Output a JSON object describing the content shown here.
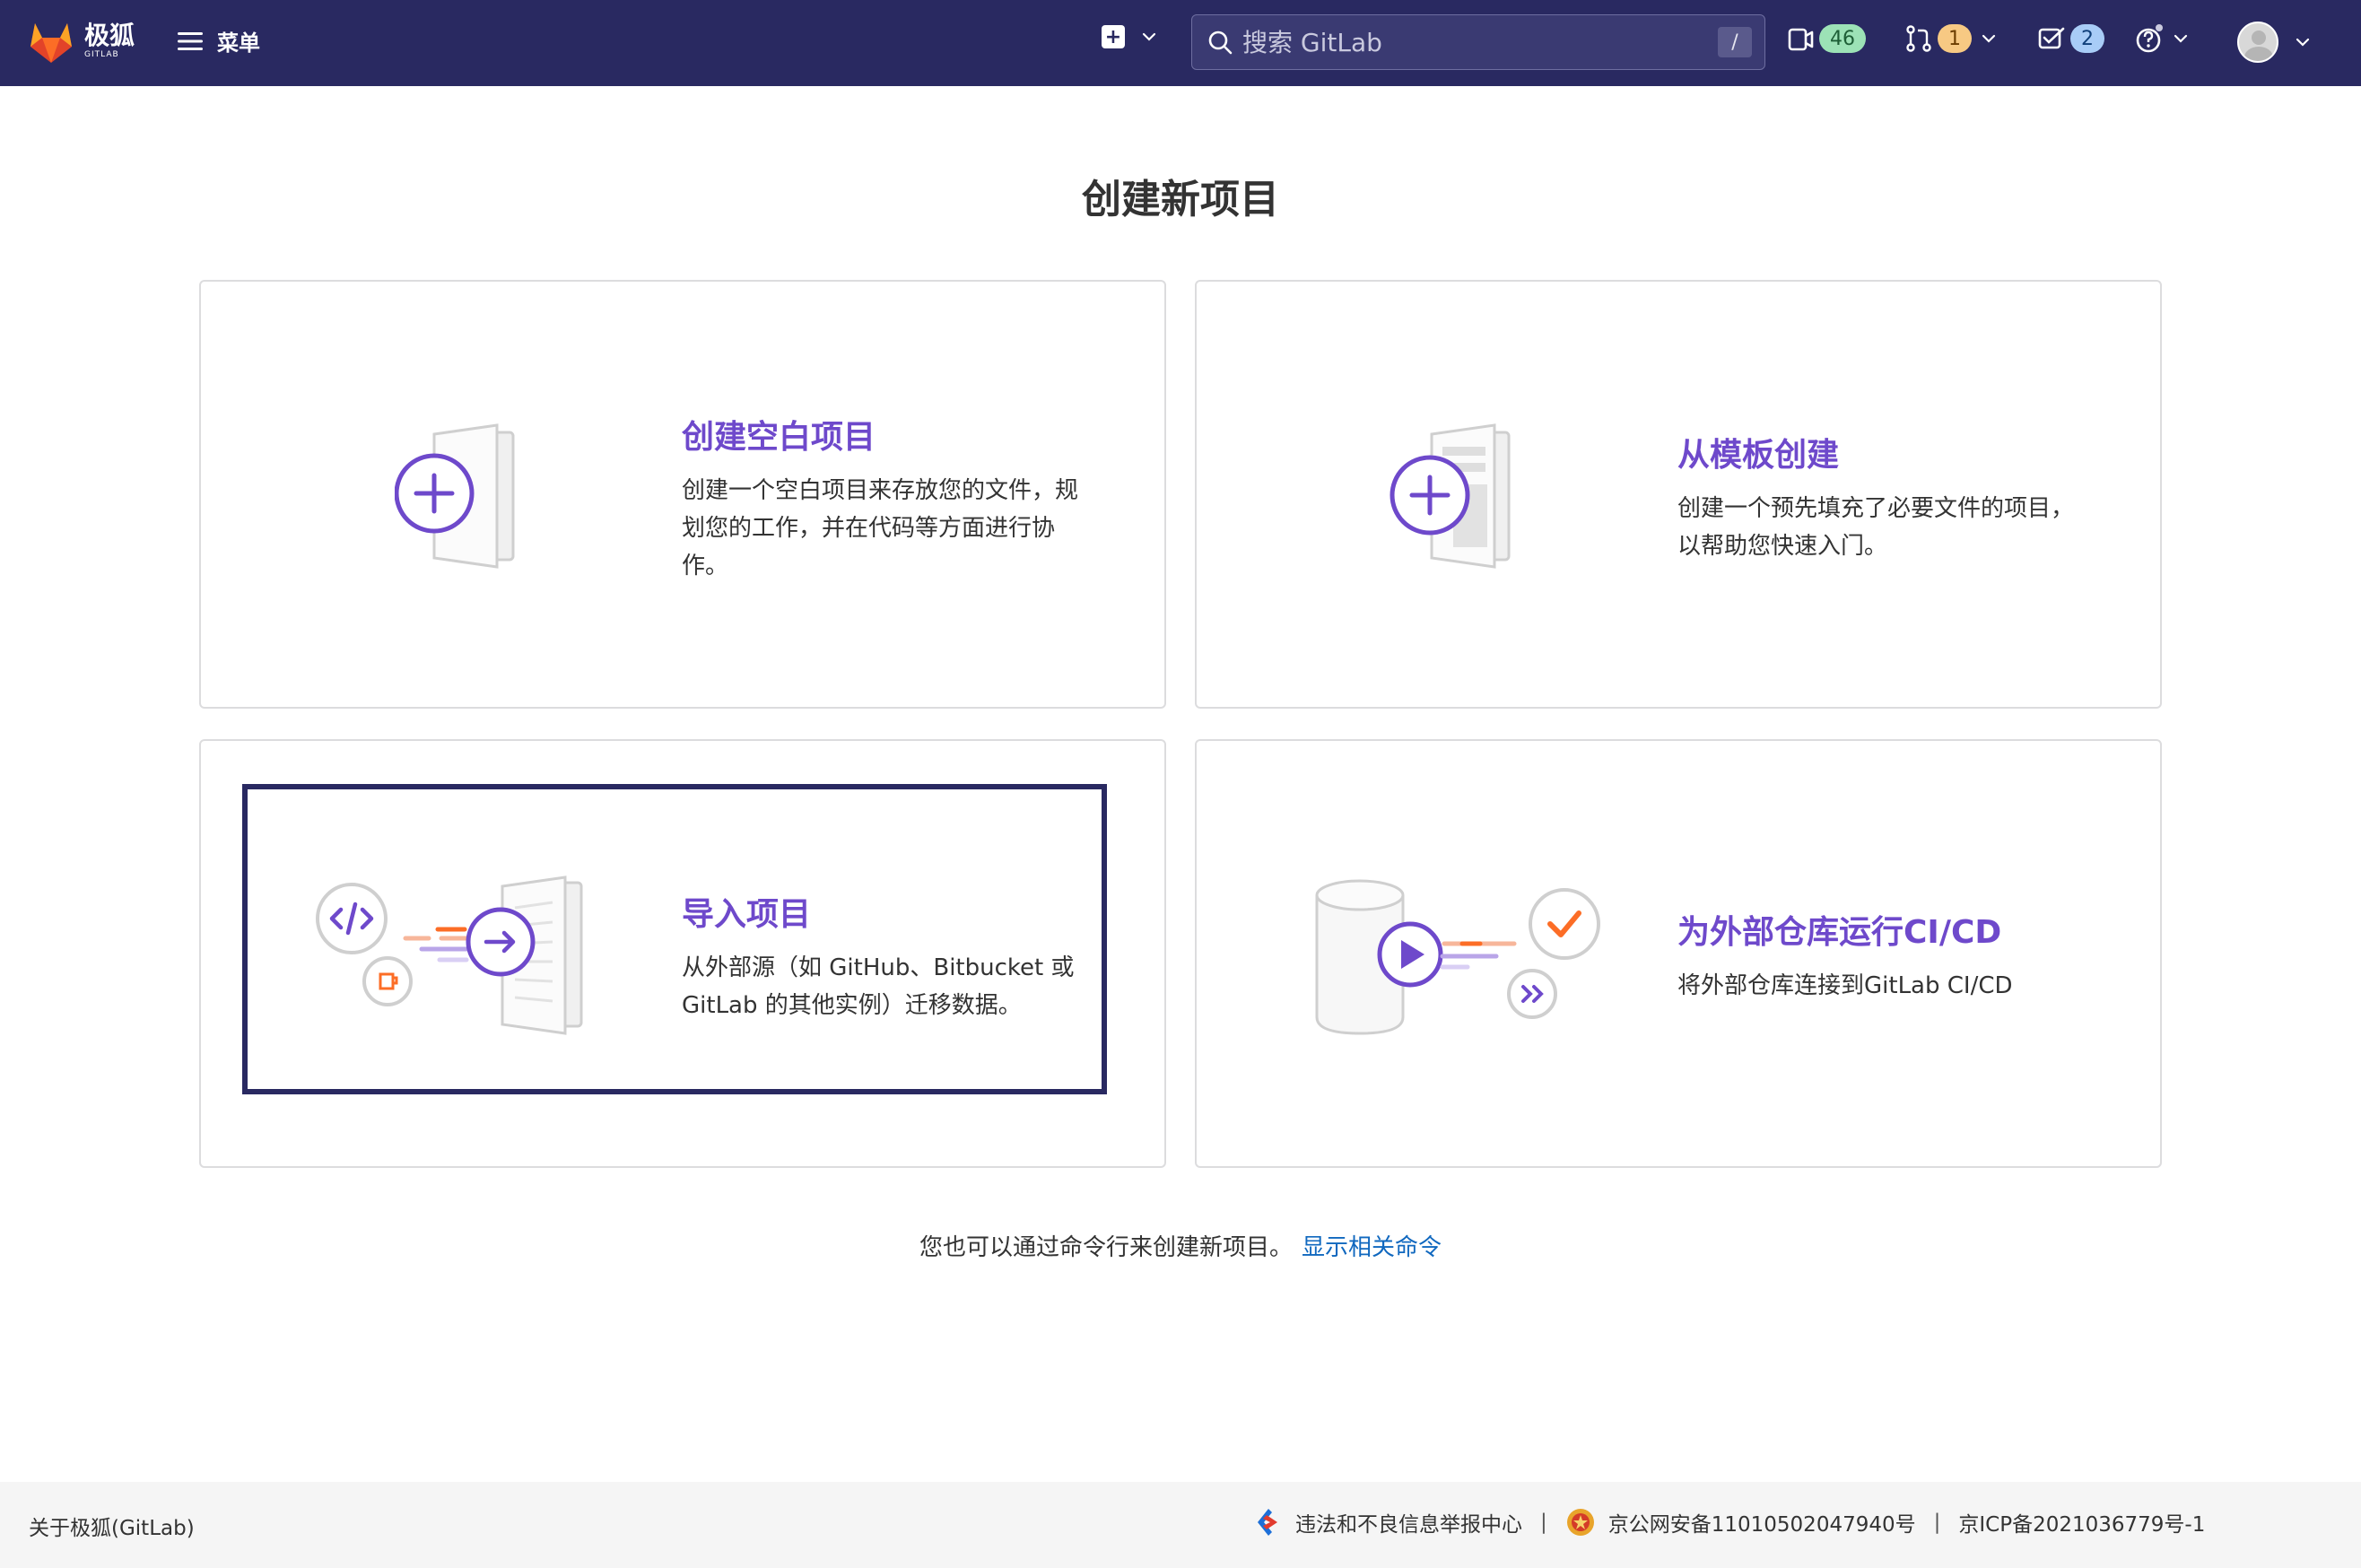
{
  "header": {
    "brand_name": "极狐",
    "brand_sub": "GITLAB",
    "menu_label": "菜单",
    "search_placeholder": "搜索 GitLab",
    "search_shortcut": "/",
    "issues_count": "46",
    "merge_requests_count": "1",
    "todos_count": "2",
    "accent_color": "#292961"
  },
  "main": {
    "title": "创建新项目",
    "cards": [
      {
        "title": "创建空白项目",
        "description": "创建一个空白项目来存放您的文件，规划您的工作，并在代码等方面进行协作。"
      },
      {
        "title": "从模板创建",
        "description": "创建一个预先填充了必要文件的项目，以帮助您快速入门。"
      },
      {
        "title": "导入项目",
        "description": "从外部源（如 GitHub、Bitbucket 或 GitLab 的其他实例）迁移数据。"
      },
      {
        "title": "为外部仓库运行CI/CD",
        "description": "将外部仓库连接到GitLab CI/CD"
      }
    ],
    "cli_text": "您也可以通过命令行来创建新项目。",
    "cli_link": "显示相关命令",
    "title_color": "#6e49cb"
  },
  "footer": {
    "about": "关于极狐(GitLab)",
    "report_center": "违法和不良信息举报中心",
    "police_record": "京公网安备11010502047940号",
    "icp_record": "京ICP备2021036779号-1",
    "separator": "|"
  }
}
